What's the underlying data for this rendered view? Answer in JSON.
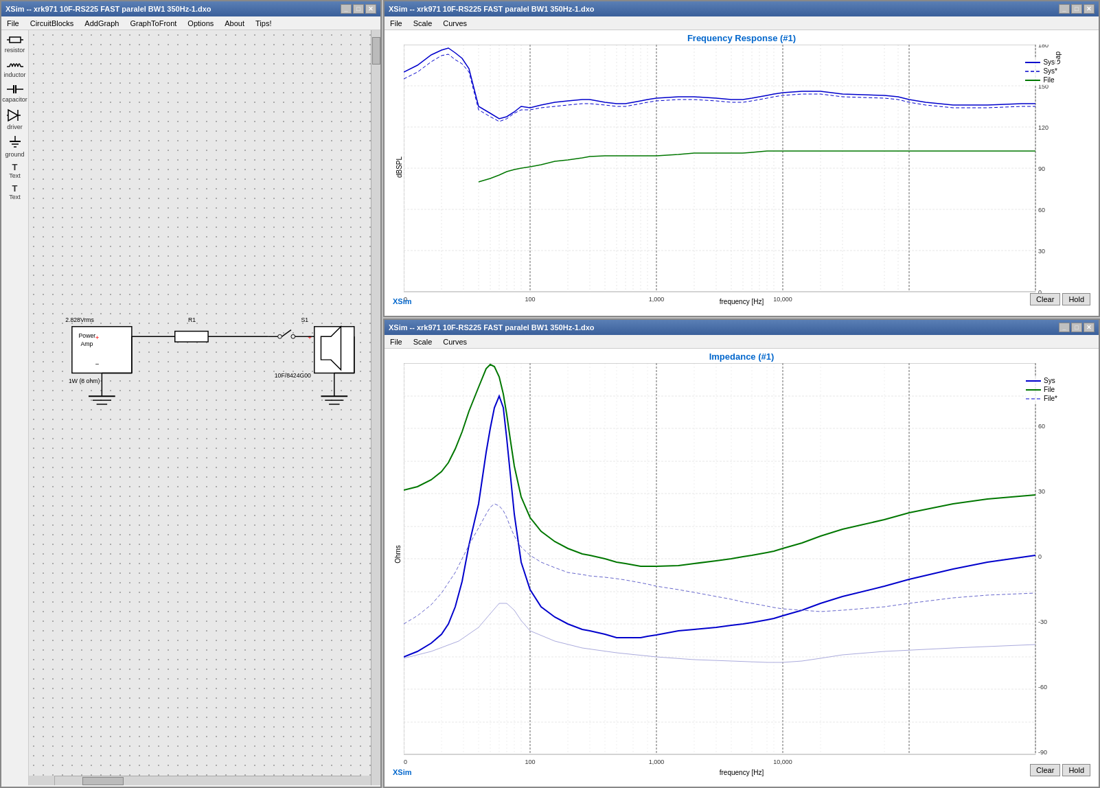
{
  "schematic": {
    "title": "XSim -- xrk971 10F-RS225 FAST paralel BW1 350Hz-1.dxo",
    "menu": [
      "File",
      "CircuitBlocks",
      "AddGraph",
      "GraphToFront",
      "Options",
      "About",
      "Tips!"
    ],
    "tools": [
      {
        "name": "resistor",
        "symbol": "resistor"
      },
      {
        "name": "inductor",
        "symbol": "inductor"
      },
      {
        "name": "capacitor",
        "symbol": "capacitor"
      },
      {
        "name": "driver",
        "symbol": "driver"
      },
      {
        "name": "ground",
        "symbol": "ground"
      },
      {
        "name": "Text",
        "symbol": "Text"
      },
      {
        "name": "Text",
        "symbol": "Text"
      }
    ],
    "circuit": {
      "voltage_label": "2.828Vrms",
      "power_label": "1W (8 ohm)",
      "r1_label": "R1",
      "s1_label": "S1",
      "driver_label": "10F/8424G00"
    }
  },
  "freq_graph": {
    "title": "XSim -- xrk971 10F-RS225 FAST paralel BW1 350Hz-1.dxo",
    "menu": [
      "File",
      "Scale",
      "Curves"
    ],
    "graph_title": "Frequency Response (#1)",
    "x_label": "frequency [Hz]",
    "y_left_label": "dBSPL",
    "y_right_label": "Gap",
    "y_left_min": 60,
    "y_left_max": 120,
    "y_right_min": -180,
    "y_right_max": 180,
    "x_min": 10,
    "x_max": 20000,
    "legend": [
      {
        "label": "Sys",
        "color": "#0000ff",
        "style": "solid"
      },
      {
        "label": "Sys*",
        "color": "#0000ff",
        "style": "dashed"
      },
      {
        "label": "File",
        "color": "#009900",
        "style": "solid"
      }
    ],
    "xsim_label": "XSim",
    "clear_label": "Clear",
    "hold_label": "Hold"
  },
  "imp_graph": {
    "title": "XSim -- xrk971 10F-RS225 FAST paralel BW1 350Hz-1.dxo",
    "menu": [
      "File",
      "Scale",
      "Curves"
    ],
    "graph_title": "Impedance (#1)",
    "x_label": "frequency [Hz]",
    "y_left_label": "Ohms",
    "y_right_label": "Gap",
    "y_left_min": 0,
    "y_left_max": 24,
    "y_right_min": -90,
    "y_right_max": 90,
    "x_min": 10,
    "x_max": 20000,
    "legend": [
      {
        "label": "Sys",
        "color": "#0000ff",
        "style": "solid"
      },
      {
        "label": "File",
        "color": "#009900",
        "style": "solid"
      },
      {
        "label": "File*",
        "color": "#0000ff",
        "style": "dashed"
      }
    ],
    "xsim_label": "XSim",
    "clear_label": "Clear",
    "hold_label": "Hold"
  }
}
